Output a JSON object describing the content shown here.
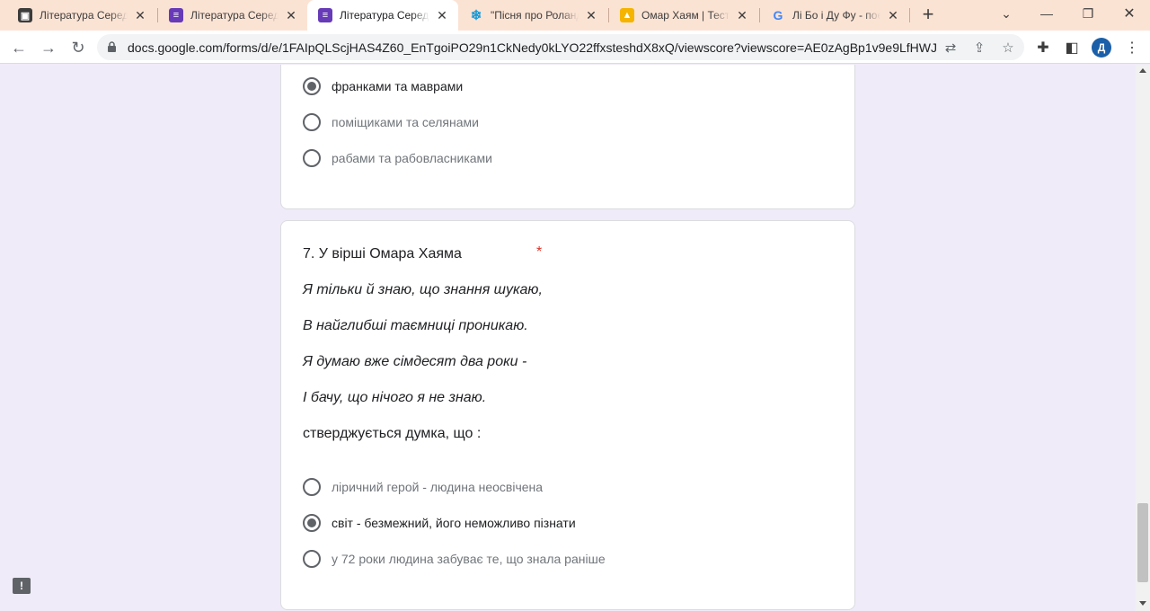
{
  "tabs": [
    {
      "title": "Література Середн",
      "favicon": "classroom",
      "color": "#3c3c3c",
      "active": false
    },
    {
      "title": "Література Середн",
      "favicon": "forms",
      "color": "#673ab7",
      "active": false
    },
    {
      "title": "Література Середн",
      "favicon": "forms",
      "color": "#673ab7",
      "active": true
    },
    {
      "title": "\"Пісня про Роланд",
      "favicon": "snowflake",
      "color": "#1a9bd7",
      "active": false
    },
    {
      "title": "Омар Хаям | Тест з",
      "favicon": "test",
      "color": "#f4b400",
      "active": false
    },
    {
      "title": "Лі Бо і Ду Фу - поє",
      "favicon": "google",
      "color": "#4285f4",
      "active": false
    }
  ],
  "toolbar": {
    "url": "docs.google.com/forms/d/e/1FAIpQLScjHAS4Z60_EnTgoiPO29n1CkNedy0kLYO22ffxsteshdX8xQ/viewscore?viewscore=AE0zAgBp1v9e9LfHWJju...",
    "profile_initial": "Д"
  },
  "question6": {
    "options": [
      {
        "label": "франками та маврами",
        "selected": true
      },
      {
        "label": "поміщиками та селянами",
        "selected": false
      },
      {
        "label": "рабами та рабовласниками",
        "selected": false
      }
    ]
  },
  "question7": {
    "title": "7. У вірші Омара Хаяма",
    "required_mark": "*",
    "poem": [
      "Я тільки й знаю, що знання шукаю,",
      "В найглибші таємниці проникаю.",
      "Я думаю вже сімдесят два роки -",
      "І бачу, що нічого я не знаю."
    ],
    "tail": "стверджується думка, що :",
    "options": [
      {
        "label": "ліричний герой - людина неосвічена",
        "selected": false
      },
      {
        "label": "світ - безмежний, його неможливо пізнати",
        "selected": true
      },
      {
        "label": "у 72 роки людина забуває те, що знала раніше",
        "selected": false
      }
    ]
  }
}
